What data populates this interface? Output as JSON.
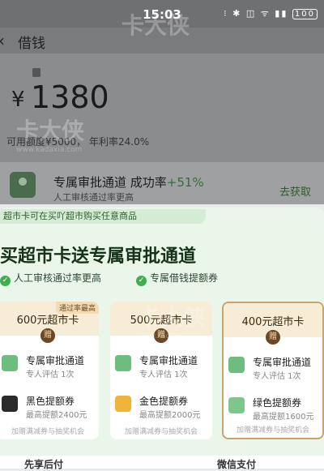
{
  "status": {
    "time": "15:03",
    "icons": "⁝ ✱ ◫ ᯤ ▮▮",
    "battery": "100"
  },
  "nav": {
    "back_icon": "back-arrow-icon",
    "title": "借钱"
  },
  "amount": {
    "currency": "¥",
    "value": "1380"
  },
  "credit_info": "可用额度¥5000， 年利率24.0%",
  "card": {
    "title": "专属审批通道 成功率",
    "pct": "+51%",
    "subtitle": "人工审核通过率更高",
    "action": "去获取"
  },
  "popup": {
    "note": "超市卡可在买吖超市购买任意商品",
    "title": "买超市卡送专属审批通道",
    "benefits": [
      "人工审核通过率更高",
      "专属借钱提额券"
    ],
    "options": [
      {
        "name": "600元超市卡",
        "tag": "通过率最高",
        "gift": "赠",
        "row1_title": "专属审批通道",
        "row1_sub": "专人评估 1次",
        "row2_title": "黑色提额券",
        "row2_sub": "最高提额2400元",
        "footer": "加赠满减券与抽奖机会"
      },
      {
        "name": "500元超市卡",
        "gift": "赠",
        "row1_title": "专属审批通道",
        "row1_sub": "专人评估 1次",
        "row2_title": "金色提额券",
        "row2_sub": "最高提额2000元",
        "footer": "加赠满减券与抽奖机会"
      },
      {
        "name": "400元超市卡",
        "gift": "赠",
        "row1_title": "专属审批通道",
        "row1_sub": "专人评估 1次",
        "row2_title": "绿色提额券",
        "row2_sub": "最高提额1600元",
        "footer": "加赠满减券与抽奖机会"
      }
    ]
  },
  "bottom": {
    "left": "先享后付",
    "right": "微信支付"
  },
  "watermark": {
    "text": "卡大侠",
    "url": "www.kadaxia.com"
  },
  "colors": {
    "accent_green": "#3fae52",
    "gold_border": "#c9a46a",
    "percent_green": "#3a6b3b"
  }
}
